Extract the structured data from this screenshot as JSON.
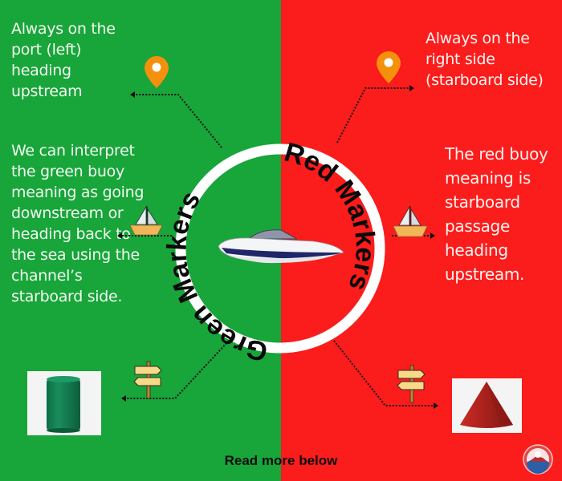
{
  "colors": {
    "green": "#18a53a",
    "red": "#fb1c1c",
    "pin": "#f5900c",
    "ring": "#ffffff"
  },
  "left": {
    "heading_note": "Always on the port (left) heading upstream",
    "description": "We can interpret the green buoy meaning as going downstream or heading back to the sea using the channel’s starboard side.",
    "ring_label": "Green Markers",
    "buoy_shape": "green-cylinder-can-buoy"
  },
  "right": {
    "heading_note": "Always on the right side (starboard side)",
    "description": "The red buoy meaning is starboard passage heading upstream.",
    "ring_label": "Red Markers",
    "buoy_shape": "red-cone-nun-buoy"
  },
  "center": {
    "image": "speedboat"
  },
  "icons": [
    "location-pin-icon",
    "sailboat-icon",
    "signpost-icon",
    "logo-icon"
  ],
  "footer": {
    "cta": "Read more below"
  }
}
